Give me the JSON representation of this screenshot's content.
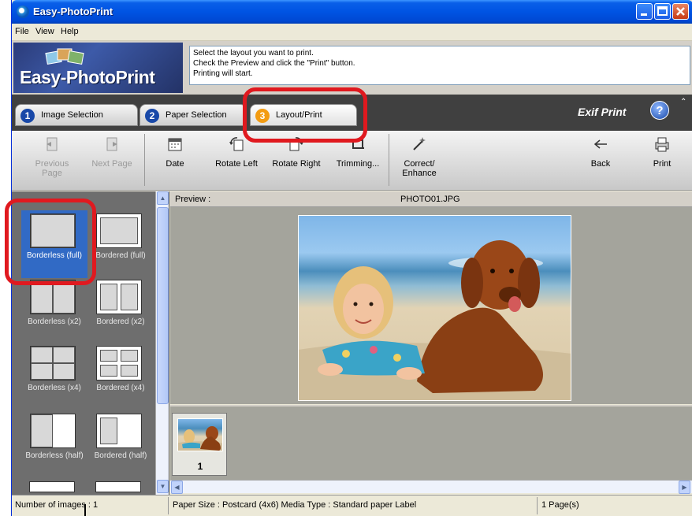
{
  "window": {
    "title": "Easy-PhotoPrint"
  },
  "menu": [
    "File",
    "View",
    "Help"
  ],
  "header": {
    "logo_text": "Easy-PhotoPrint",
    "instructions": [
      "Select the layout you want to print.",
      "Check the Preview and click the \"Print\" button.",
      "Printing will start."
    ]
  },
  "steps": [
    {
      "number": "1",
      "label": "Image Selection"
    },
    {
      "number": "2",
      "label": "Paper Selection"
    },
    {
      "number": "3",
      "label": "Layout/Print",
      "active": true
    }
  ],
  "exif_print": "Exif Print",
  "help_label": "?",
  "toolbar": {
    "previous": "Previous Page",
    "next": "Next Page",
    "date": "Date",
    "rotate_left": "Rotate Left",
    "rotate_right": "Rotate Right",
    "trimming": "Trimming...",
    "correct": "Correct/ Enhance",
    "back": "Back",
    "print": "Print"
  },
  "layouts": [
    {
      "label": "Borderless (full)",
      "selected": true
    },
    {
      "label": "Bordered (full)"
    },
    {
      "label": "Borderless (x2)"
    },
    {
      "label": "Bordered (x2)"
    },
    {
      "label": "Borderless (x4)"
    },
    {
      "label": "Bordered (x4)"
    },
    {
      "label": "Borderless (half)"
    },
    {
      "label": "Bordered (half)"
    }
  ],
  "preview": {
    "label": "Preview :",
    "filename": "PHOTO01.JPG"
  },
  "thumbnails": [
    {
      "index": "1"
    }
  ],
  "status": {
    "images": "Number of images : 1",
    "paper": "Paper Size : Postcard (4x6)  Media Type : Standard paper Label",
    "pages": "1 Page(s)"
  },
  "colors": {
    "highlight": "#e0191f",
    "titlebar": "#0054e3",
    "selection": "#316ac5"
  }
}
